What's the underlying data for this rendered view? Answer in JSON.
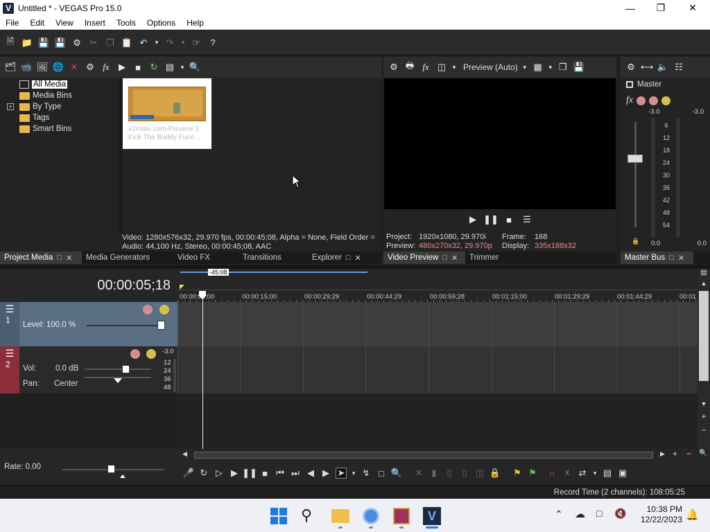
{
  "window": {
    "title": "Untitled * - VEGAS Pro 15.0",
    "logo": "V"
  },
  "menu": [
    "File",
    "Edit",
    "View",
    "Insert",
    "Tools",
    "Options",
    "Help"
  ],
  "project_media": {
    "tree": [
      "All Media",
      "Media Bins",
      "By Type",
      "Tags",
      "Smart Bins"
    ],
    "expand_marker": "+",
    "thumbnail": {
      "line1": "x2mate.com-Preview 3",
      "line2": "Kick The Buddy Funn..."
    },
    "info_video": "Video: 1280x576x32, 29.970 fps, 00:00:45;08, Alpha = None, Field Order =",
    "info_audio": "Audio: 44,100 Hz, Stereo, 00:00:45;08, AAC"
  },
  "tabs_left": [
    "Project Media",
    "Media Generators",
    "Video FX",
    "Transitions",
    "Explorer"
  ],
  "preview": {
    "mode": "Preview (Auto)",
    "project_label": "Project:",
    "project_value": "1920x1080, 29.970i",
    "preview_label": "Preview:",
    "preview_value": "480x270x32, 29.970p",
    "frame_label": "Frame:",
    "frame_value": "168",
    "display_label": "Display:",
    "display_value": "335x188x32"
  },
  "tabs_mid": [
    "Video Preview",
    "Trimmer"
  ],
  "master": {
    "label": "Master",
    "peak_left": "-3.0",
    "peak_right": "-3.0",
    "scale": [
      "6",
      "12",
      "18",
      "24",
      "30",
      "36",
      "42",
      "48",
      "54"
    ],
    "bottom_left": "0.0",
    "bottom_right": "0.0",
    "tab": "Master Bus"
  },
  "timeline": {
    "timecode": "00:00:05;18",
    "region_length": "-45:08",
    "ruler": [
      "00:00:00;00",
      "00:00:15;00",
      "00:00:29;29",
      "00:00:44;29",
      "00:00:59;28",
      "00:01:15;00",
      "00:01:29;29",
      "00:01:44;29",
      "00:01"
    ],
    "video_track": {
      "number": "1",
      "level": "Level: 100.0 %"
    },
    "audio_track": {
      "number": "2",
      "vol_label": "Vol:",
      "vol_value": "0.0 dB",
      "pan_label": "Pan:",
      "pan_value": "Center",
      "peak": "-3.0",
      "scale": [
        "12",
        "24",
        "36",
        "48"
      ]
    },
    "rate": "Rate: 0.00"
  },
  "status": {
    "record_time": "Record Time (2 channels): 108:05:25"
  },
  "taskbar": {
    "time": "10:38 PM",
    "date": "12/22/2023"
  },
  "colors": {
    "accent_video": "#5a6e84",
    "accent_audio": "#8c2d3a",
    "preview_value": "#e89090"
  }
}
